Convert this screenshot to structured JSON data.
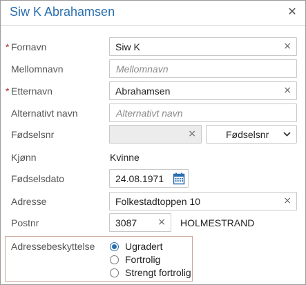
{
  "dialog": {
    "title": "Siw K Abrahamsen",
    "close_icon": "close-icon"
  },
  "fields": {
    "fornavn": {
      "label": "Fornavn",
      "required_mark": "*",
      "value": "Siw K"
    },
    "mellomnavn": {
      "label": "Mellomnavn",
      "placeholder": "Mellomnavn"
    },
    "etternavn": {
      "label": "Etternavn",
      "required_mark": "*",
      "value": "Abrahamsen"
    },
    "alternativt_navn": {
      "label": "Alternativt navn",
      "placeholder": "Alternativt navn"
    },
    "fodselsnr": {
      "label": "Fødselsnr",
      "type_select": "Fødselsnr"
    },
    "kjonn": {
      "label": "Kjønn",
      "value": "Kvinne"
    },
    "fodselsdato": {
      "label": "Fødselsdato",
      "value": "24.08.1971"
    },
    "adresse": {
      "label": "Adresse",
      "value": "Folkestadtoppen 10"
    },
    "postnr": {
      "label": "Postnr",
      "value": "3087",
      "poststed": "HOLMESTRAND"
    }
  },
  "adressebeskyttelse": {
    "label": "Adressebeskyttelse",
    "options": [
      {
        "label": "Ugradert",
        "selected": true
      },
      {
        "label": "Fortrolig",
        "selected": false
      },
      {
        "label": "Strengt fortrolig",
        "selected": false
      }
    ]
  },
  "colors": {
    "accent": "#2a6ead",
    "required": "#b72b2b"
  },
  "clear_glyph": "×"
}
